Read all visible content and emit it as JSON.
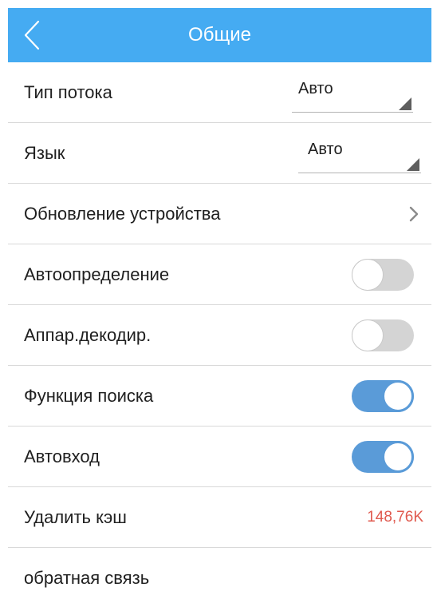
{
  "header": {
    "title": "Общие",
    "back_icon": "chevron-left-icon",
    "background_color": "#45abf2"
  },
  "settings": {
    "stream_type": {
      "label": "Тип потока",
      "value": "Авто"
    },
    "language": {
      "label": "Язык",
      "value": "Авто"
    },
    "device_update": {
      "label": "Обновление устройства",
      "icon": "chevron-right-icon"
    },
    "auto_detect": {
      "label": "Автоопределение",
      "enabled": false
    },
    "hw_decode": {
      "label": "Аппар.декодир.",
      "enabled": false
    },
    "search_function": {
      "label": "Функция поиска",
      "enabled": true
    },
    "auto_login": {
      "label": "Автовход",
      "enabled": true
    },
    "clear_cache": {
      "label": "Удалить кэш",
      "value": "148,76K",
      "value_color": "#e05a4f"
    },
    "feedback": {
      "label": "обратная связь"
    }
  },
  "colors": {
    "toggle_on": "#5a9bd8",
    "toggle_off": "#d4d4d4"
  }
}
